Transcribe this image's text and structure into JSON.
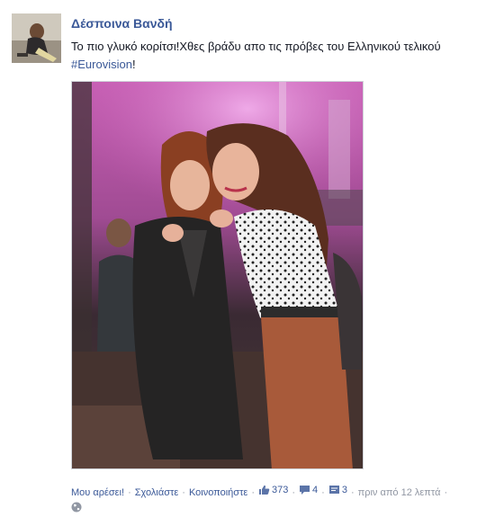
{
  "post": {
    "author": "Δέσποινα Βανδή",
    "text": "Το πιο γλυκό κορίτσι!Χθες βράδυ απο τις πρόβες του Ελληνικού τελικού",
    "hashtag": "#Eurovision",
    "hashtag_suffix": "!"
  },
  "actions": {
    "like": "Μου αρέσει!",
    "comment": "Σχολιάστε",
    "share": "Κοινοποιήστε",
    "likes_count": "373",
    "comments_count": "4",
    "shares_count": "3",
    "timestamp": "πριν από 12 λεπτά",
    "separator": "·"
  },
  "colors": {
    "link": "#3b5998",
    "meta": "#9197a3",
    "text": "#141823"
  }
}
